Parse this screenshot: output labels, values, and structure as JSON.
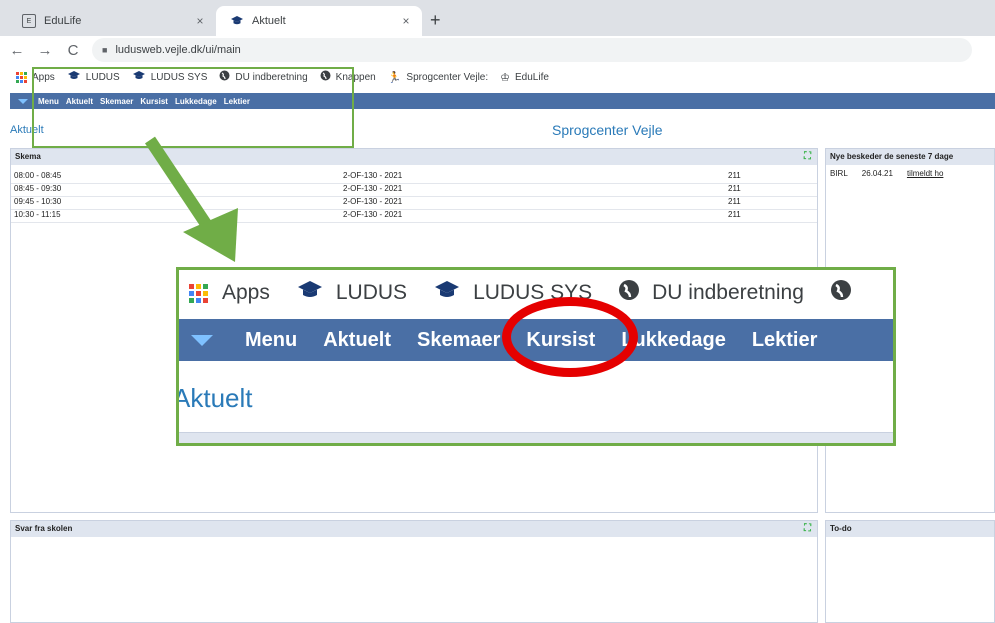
{
  "browser": {
    "tabs": [
      {
        "title": "EduLife",
        "active": false
      },
      {
        "title": "Aktuelt",
        "active": true
      }
    ],
    "close_glyph": "×",
    "new_tab_glyph": "+",
    "url": "ludusweb.vejle.dk/ui/main",
    "nav": {
      "back": "←",
      "forward": "→",
      "reload": "C"
    },
    "bookmarks": [
      {
        "label": "Apps",
        "icon": "apps-grid-icon"
      },
      {
        "label": "LUDUS",
        "icon": "graduation-cap-icon"
      },
      {
        "label": "LUDUS SYS",
        "icon": "graduation-cap-icon"
      },
      {
        "label": "DU indberetning",
        "icon": "globe-icon"
      },
      {
        "label": "Knappen",
        "icon": "globe-icon"
      },
      {
        "label": "Sprogcenter Vejle:",
        "icon": "runner-icon"
      },
      {
        "label": "EduLife",
        "icon": "crown-icon"
      }
    ]
  },
  "app": {
    "menu": [
      "Menu",
      "Aktuelt",
      "Skemaer",
      "Kursist",
      "Lukkedage",
      "Lektier"
    ],
    "breadcrumb": "Aktuelt",
    "site_title": "Sprogcenter Vejle",
    "schedule": {
      "title": "Skema",
      "rows": [
        {
          "time": "08:00 - 08:45",
          "class": "2-OF-130 - 2021",
          "room": "211"
        },
        {
          "time": "08:45 - 09:30",
          "class": "2-OF-130 - 2021",
          "room": "211"
        },
        {
          "time": "09:45 - 10:30",
          "class": "2-OF-130 - 2021",
          "room": "211"
        },
        {
          "time": "10:30 - 11:15",
          "class": "2-OF-130 - 2021",
          "room": "211"
        }
      ]
    },
    "messages": {
      "title": "Nye beskeder de seneste 7 dage",
      "rows": [
        {
          "from": "BIRL",
          "date": "26.04.21",
          "text": "tilmeldt ho"
        }
      ]
    },
    "school_replies": {
      "title": "Svar fra skolen"
    },
    "todo": {
      "title": "To-do"
    }
  },
  "zoom": {
    "bookmarks": [
      "Apps",
      "LUDUS",
      "LUDUS SYS",
      "DU indberetning"
    ],
    "menu": [
      "Menu",
      "Aktuelt",
      "Skemaer",
      "Kursist",
      "Lukkedage",
      "Lektier"
    ],
    "breadcrumb": "Aktuelt"
  },
  "colors": {
    "menu_bar": "#4a6fa5",
    "highlight_box": "#70ad47",
    "highlight_circle": "#e50000",
    "link_blue": "#2a7ab8"
  }
}
